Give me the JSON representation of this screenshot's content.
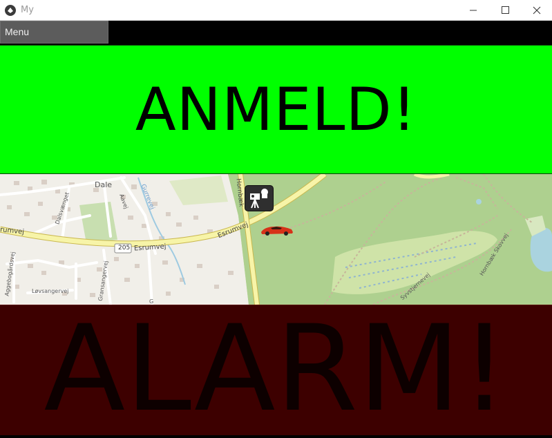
{
  "window": {
    "title": "My",
    "icons": {
      "app": "app-logo-icon",
      "minimize": "minimize-icon",
      "maximize": "maximize-icon",
      "close": "close-icon"
    }
  },
  "menu": {
    "label": "Menu"
  },
  "report_button": {
    "label": "ANMELD!",
    "color": "#00ff00"
  },
  "map": {
    "labels": {
      "town": "Dale",
      "road_west": "Esrumvej",
      "road_east": "Esrumvej",
      "road_number": "205",
      "road_north": "Hornbæk",
      "stream": "Gurrevej",
      "street_dalsvaenget": "Dalsvænget",
      "street_a": "Aavej",
      "street_aggebo": "Aggebogårdsvej",
      "street_lovs": "Løvsangervej",
      "street_grans": "Gransangervej",
      "street_g": "G",
      "trail_syn": "Syvstjernevej",
      "trail_horn": "Hornbæk Skovvej",
      "edge_road": "rumvej"
    },
    "markers": {
      "camera": "speed-camera-icon",
      "car": "red-car-icon"
    }
  },
  "alarm_button": {
    "label": "ALARM!",
    "color": "#3d0000"
  }
}
